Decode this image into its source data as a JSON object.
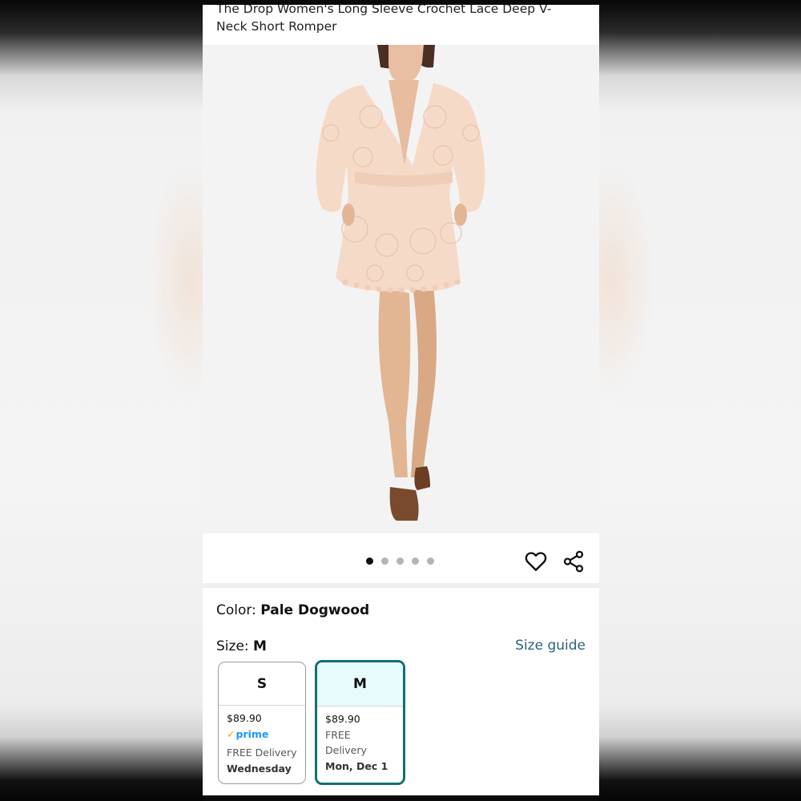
{
  "product": {
    "title": "The Drop Women's Long Sleeve Crochet Lace Deep V-Neck Short Romper"
  },
  "gallery": {
    "image_count": 5,
    "active_index": 0,
    "heart_icon": "heart-outline-icon",
    "share_icon": "share-icon"
  },
  "color": {
    "label": "Color: ",
    "value": "Pale Dogwood"
  },
  "size": {
    "label": "Size: ",
    "value": "M",
    "guide_label": "Size guide",
    "options": [
      {
        "size": "S",
        "price": "$89.90",
        "prime": "prime",
        "delivery": "FREE Delivery",
        "date": "Wednesday",
        "selected": false
      },
      {
        "size": "M",
        "price": "$89.90",
        "delivery": "FREE Delivery",
        "date": "Mon, Dec 1",
        "selected": true
      }
    ]
  },
  "colors": {
    "accent": "#117174",
    "link": "#2a6478",
    "selected_bg": "#e7fbfd",
    "prime_blue": "#1a98ff",
    "prime_check": "#ff9900"
  }
}
